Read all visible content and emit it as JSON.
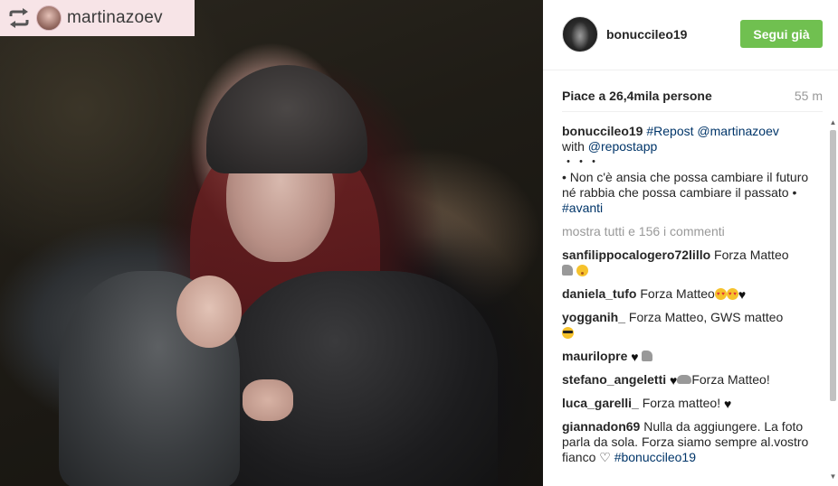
{
  "repost_badge": {
    "username": "martinazoev",
    "icon": "repost-icon"
  },
  "post": {
    "author": "bonuccileo19",
    "follow_label": "Segui già",
    "likes": "Piace a 26,4mila persone",
    "time_ago": "55 m"
  },
  "caption": {
    "author": "bonuccileo19",
    "repost_tag": "#Repost",
    "mention": "@martinazoev",
    "with_text": "with",
    "app_mention": "@repostapp",
    "dots": "・・・",
    "body": "• Non c'è ansia che possa cambiare il futuro né rabbia che possa cambiare il passato •",
    "hashtag": "#avanti"
  },
  "show_all": "mostra tutti e 156 i commenti",
  "comments": [
    {
      "user": "sanfilippocalogero72lillo",
      "text": "Forza Matteo"
    },
    {
      "user": "daniela_tufo",
      "text": "Forza Matteo"
    },
    {
      "user": "yogganih_",
      "text": "Forza Matteo, GWS matteo"
    },
    {
      "user": "maurilopre",
      "text": ""
    },
    {
      "user": "stefano_angeletti",
      "text": "Forza Matteo!"
    },
    {
      "user": "luca_garelli_",
      "text": "Forza matteo!"
    },
    {
      "user": "giannadon69",
      "text": "Nulla da aggiungere. La foto parla da sola. Forza siamo sempre al.vostro fianco ♡",
      "hashtag": "#bonuccileo19"
    }
  ],
  "colors": {
    "follow_button": "#70c050",
    "link": "#003569",
    "badge_bg": "#f7e4e7"
  }
}
